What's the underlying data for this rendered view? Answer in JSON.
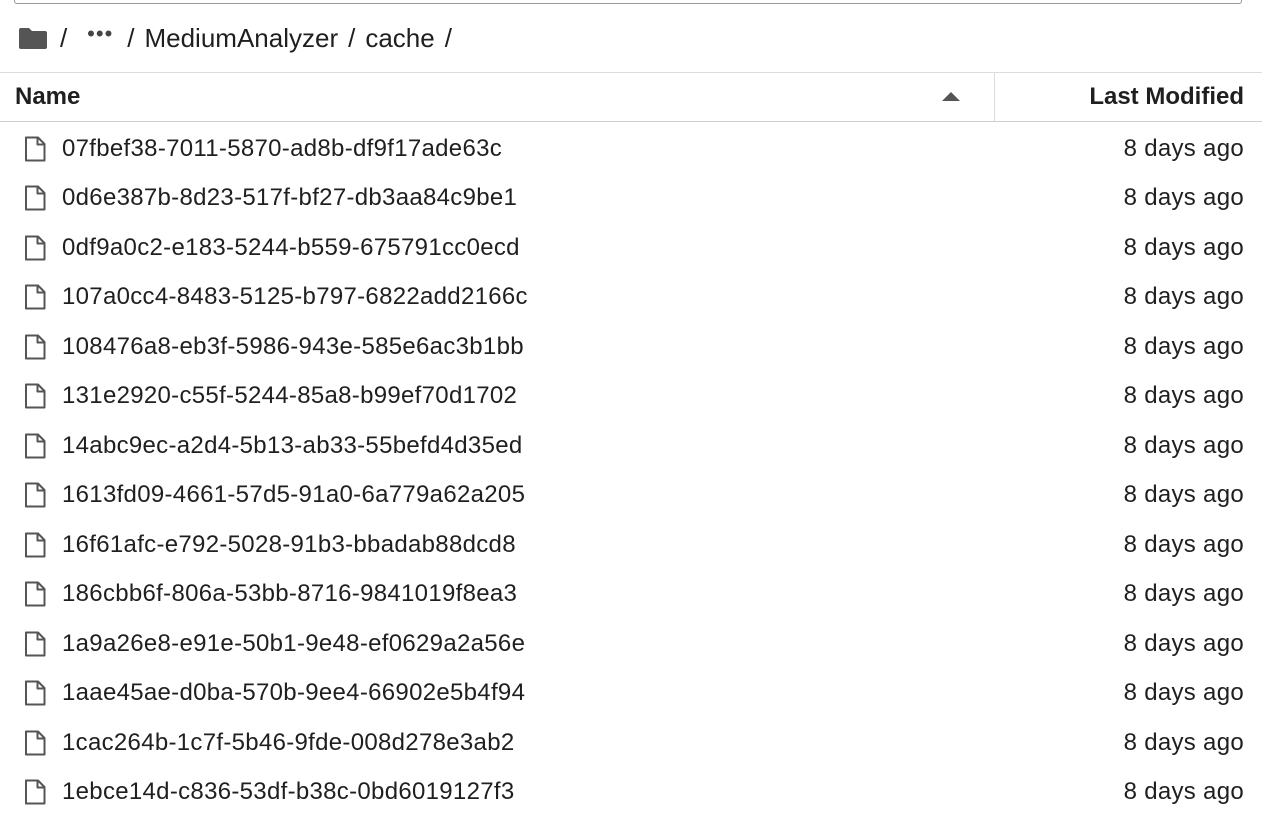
{
  "breadcrumb": {
    "root_icon": "folder-icon",
    "separator": "/",
    "ellipsis": "•••",
    "segments": [
      "MediumAnalyzer",
      "cache"
    ]
  },
  "table": {
    "columns": {
      "name": "Name",
      "modified": "Last Modified"
    },
    "sort": "name-ascending",
    "rows": [
      {
        "name": "07fbef38-7011-5870-ad8b-df9f17ade63c",
        "modified": "8 days ago"
      },
      {
        "name": "0d6e387b-8d23-517f-bf27-db3aa84c9be1",
        "modified": "8 days ago"
      },
      {
        "name": "0df9a0c2-e183-5244-b559-675791cc0ecd",
        "modified": "8 days ago"
      },
      {
        "name": "107a0cc4-8483-5125-b797-6822add2166c",
        "modified": "8 days ago"
      },
      {
        "name": "108476a8-eb3f-5986-943e-585e6ac3b1bb",
        "modified": "8 days ago"
      },
      {
        "name": "131e2920-c55f-5244-85a8-b99ef70d1702",
        "modified": "8 days ago"
      },
      {
        "name": "14abc9ec-a2d4-5b13-ab33-55befd4d35ed",
        "modified": "8 days ago"
      },
      {
        "name": "1613fd09-4661-57d5-91a0-6a779a62a205",
        "modified": "8 days ago"
      },
      {
        "name": "16f61afc-e792-5028-91b3-bbadab88dcd8",
        "modified": "8 days ago"
      },
      {
        "name": "186cbb6f-806a-53bb-8716-9841019f8ea3",
        "modified": "8 days ago"
      },
      {
        "name": "1a9a26e8-e91e-50b1-9e48-ef0629a2a56e",
        "modified": "8 days ago"
      },
      {
        "name": "1aae45ae-d0ba-570b-9ee4-66902e5b4f94",
        "modified": "8 days ago"
      },
      {
        "name": "1cac264b-1c7f-5b46-9fde-008d278e3ab2",
        "modified": "8 days ago"
      },
      {
        "name": "1ebce14d-c836-53df-b38c-0bd6019127f3",
        "modified": "8 days ago"
      }
    ],
    "row_icon": "file-icon"
  }
}
